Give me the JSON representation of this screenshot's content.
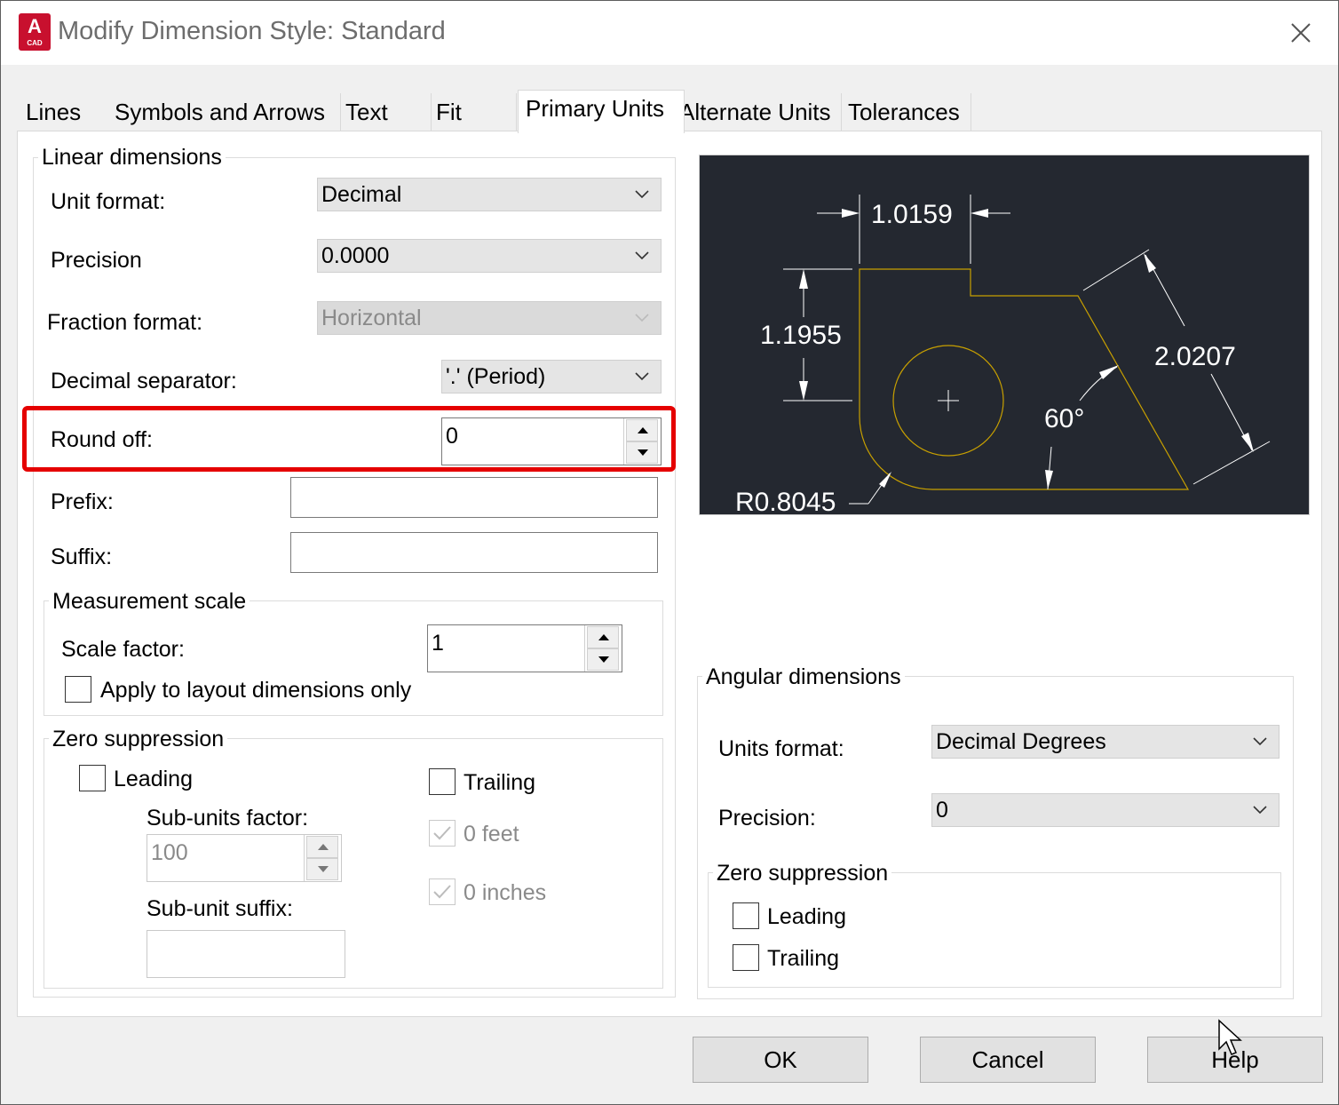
{
  "window": {
    "title": "Modify Dimension Style: Standard",
    "app_icon_letter": "A",
    "app_icon_caption": "CAD"
  },
  "tabs": [
    {
      "label": "Lines"
    },
    {
      "label": "Symbols and Arrows"
    },
    {
      "label": "Text"
    },
    {
      "label": "Fit"
    },
    {
      "label": "Primary Units",
      "active": true
    },
    {
      "label": "Alternate Units"
    },
    {
      "label": "Tolerances"
    }
  ],
  "linear": {
    "group_label": "Linear dimensions",
    "unit_format": {
      "label": "Unit format:",
      "value": "Decimal"
    },
    "precision": {
      "label": "Precision",
      "value": "0.0000"
    },
    "fraction_format": {
      "label": "Fraction format:",
      "value": "Horizontal",
      "disabled": true
    },
    "decimal_separator": {
      "label": "Decimal separator:",
      "value": "'.' (Period)"
    },
    "round_off": {
      "label": "Round off:",
      "value": "0"
    },
    "prefix": {
      "label": "Prefix:",
      "value": ""
    },
    "suffix": {
      "label": "Suffix:",
      "value": ""
    }
  },
  "measurement_scale": {
    "group_label": "Measurement scale",
    "scale_factor": {
      "label": "Scale factor:",
      "value": "1"
    },
    "apply_layout": {
      "label": "Apply to layout dimensions only",
      "checked": false
    }
  },
  "zero_suppression_linear": {
    "group_label": "Zero suppression",
    "leading": {
      "label": "Leading",
      "checked": false
    },
    "trailing": {
      "label": "Trailing",
      "checked": false
    },
    "sub_units_factor": {
      "label": "Sub-units factor:",
      "value": "100",
      "disabled": true
    },
    "sub_unit_suffix": {
      "label": "Sub-unit suffix:",
      "value": ""
    },
    "zero_feet": {
      "label": "0 feet",
      "checked": true,
      "disabled": true
    },
    "zero_inches": {
      "label": "0 inches",
      "checked": true,
      "disabled": true
    }
  },
  "preview": {
    "dim_top": "1.0159",
    "dim_left": "1.1955",
    "dim_diag": "2.0207",
    "dim_angle": "60°",
    "dim_radius": "R0.8045",
    "colors": {
      "background": "#242830",
      "geometry": "#c8a000",
      "dims": "#ffffff"
    }
  },
  "angular": {
    "group_label": "Angular dimensions",
    "units_format": {
      "label": "Units format:",
      "value": "Decimal Degrees"
    },
    "precision": {
      "label": "Precision:",
      "value": "0"
    },
    "zero_suppression": {
      "group_label": "Zero suppression",
      "leading": {
        "label": "Leading",
        "checked": false
      },
      "trailing": {
        "label": "Trailing",
        "checked": false
      }
    }
  },
  "buttons": {
    "ok": "OK",
    "cancel": "Cancel",
    "help": "Help"
  },
  "highlight_color": "#e50000"
}
